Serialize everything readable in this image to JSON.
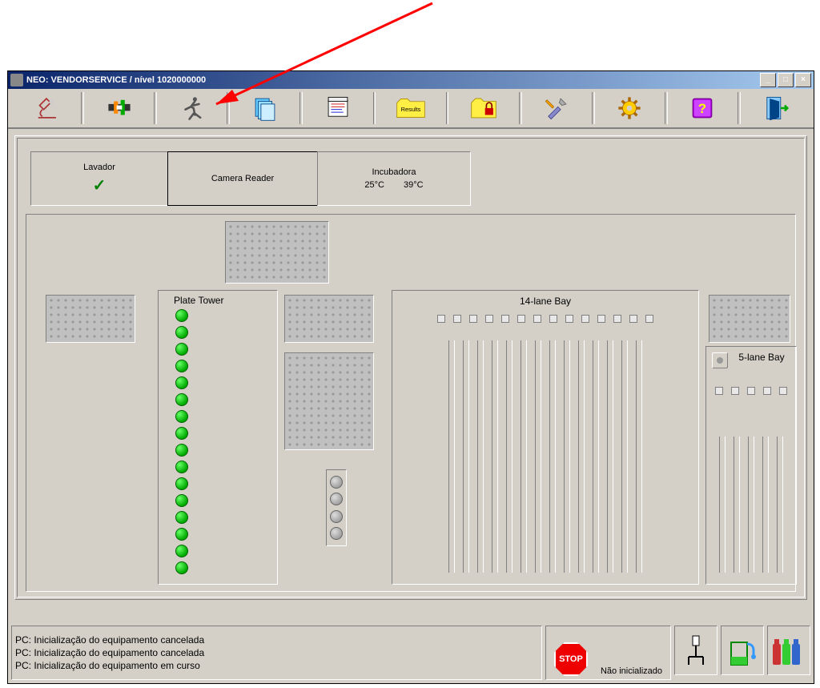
{
  "window": {
    "title": "NEO: VENDORSERVICE / nível 1020000000"
  },
  "toolbar": {
    "icons": [
      "microscope-icon",
      "pipette-arm-icon",
      "running-man-icon",
      "documents-icon",
      "worklist-icon",
      "results-folder-icon",
      "locked-folder-icon",
      "tools-icon",
      "gear-icon",
      "help-book-icon",
      "exit-door-icon"
    ],
    "results_label": "Results"
  },
  "modules": {
    "washer": {
      "label": "Lavador",
      "status_ok": true
    },
    "camera": {
      "label": "Camera Reader"
    },
    "incubator": {
      "label": "Incubadora",
      "temp1": "25°C",
      "temp2": "39°C"
    }
  },
  "deck": {
    "plate_tower": {
      "label": "Plate Tower",
      "slot_count": 16,
      "slots_green": 16
    },
    "bay14": {
      "label": "14-lane Bay",
      "lanes": 14
    },
    "bay5": {
      "label": "5-lane Bay",
      "lanes": 5
    }
  },
  "status": {
    "log": [
      "PC: Inicialização do equipamento cancelada",
      "PC: Inicialização do equipamento cancelada",
      "PC: Inicialização do equipamento em curso"
    ],
    "stop_label": "STOP",
    "init_state": "Não inicializado"
  }
}
